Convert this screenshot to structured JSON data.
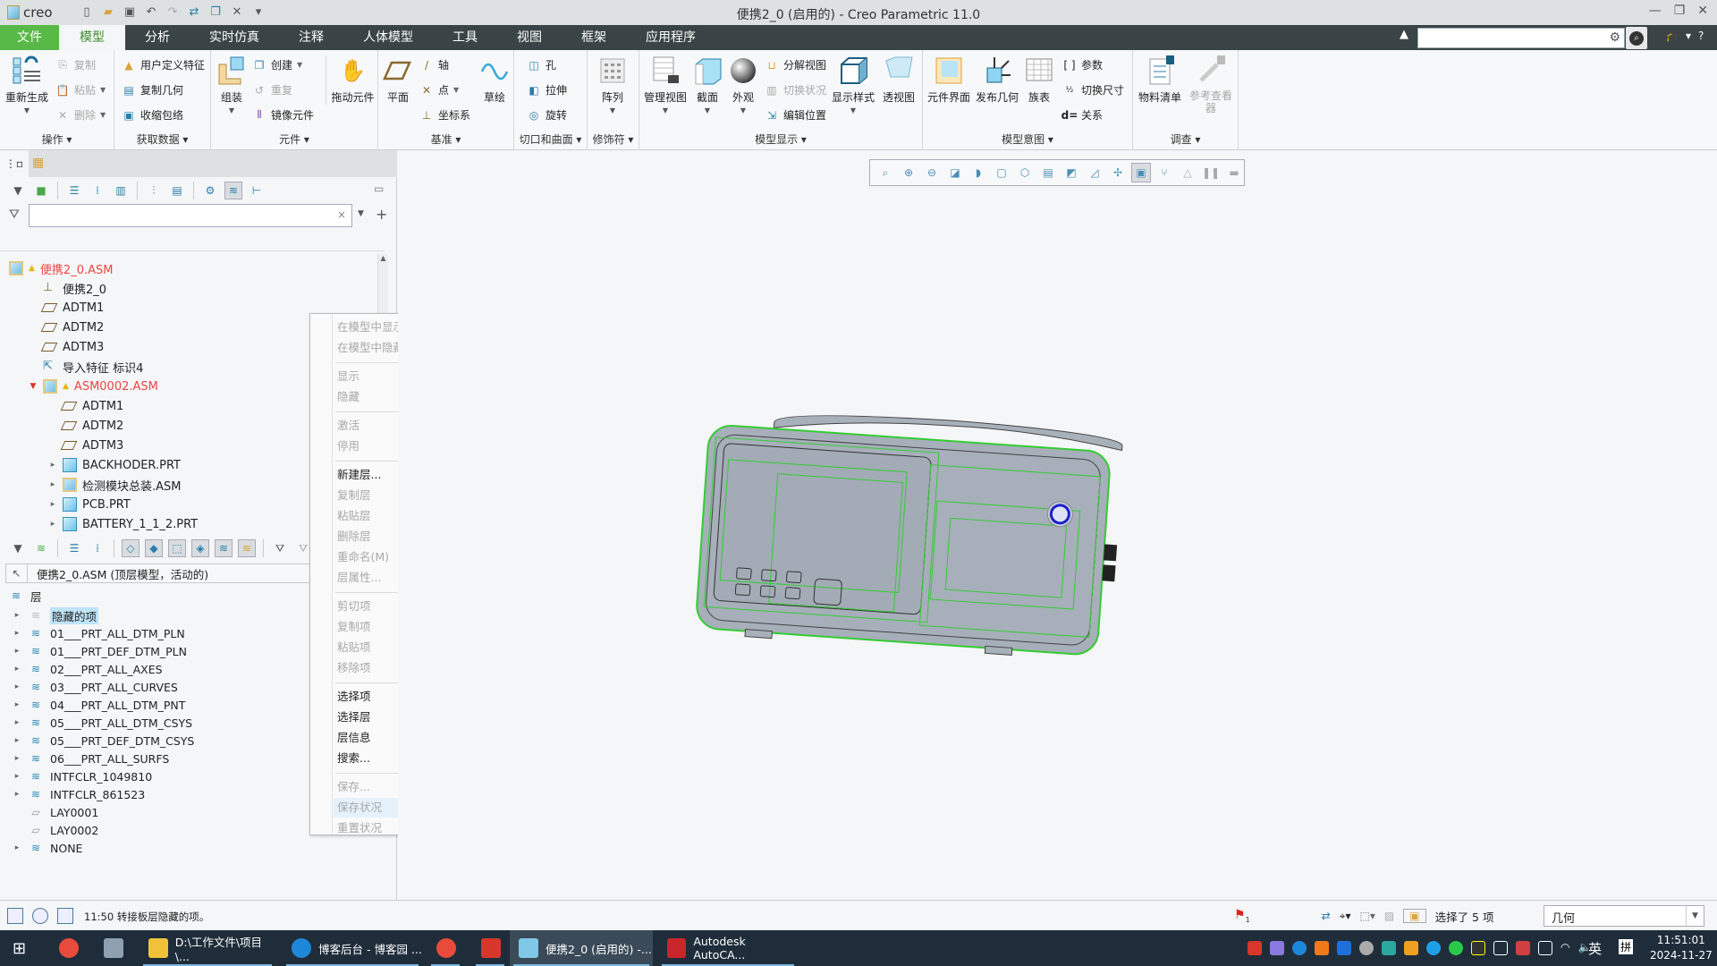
{
  "app": {
    "logo_text": "creo",
    "window_title": "便携2_0 (启用的) - Creo Parametric 11.0",
    "quick_access": [
      "new-icon",
      "open-icon",
      "save-icon",
      "undo-icon",
      "redo-icon",
      "regenerate-icon",
      "windows-icon",
      "close-icon",
      "customize-icon"
    ]
  },
  "menubar": {
    "tabs": [
      "文件",
      "模型",
      "分析",
      "实时仿真",
      "注释",
      "人体模型",
      "工具",
      "视图",
      "框架",
      "应用程序"
    ],
    "active": "模型",
    "search_placeholder": ""
  },
  "ribbon": {
    "groups": [
      {
        "label": "操作 ▾",
        "big": [
          {
            "label": "重新生成",
            "icon": "regenerate-icon"
          }
        ],
        "small": [
          {
            "label": "复制",
            "disabled": true
          },
          {
            "label": "粘贴",
            "disabled": true
          },
          {
            "label": "删除",
            "disabled": true
          }
        ]
      },
      {
        "label": "获取数据 ▾",
        "small": [
          {
            "label": "用户定义特征"
          },
          {
            "label": "复制几何"
          },
          {
            "label": "收缩包络"
          }
        ]
      },
      {
        "label": "元件 ▾",
        "big": [
          {
            "label": "组装"
          },
          {
            "label": "拖动元件"
          }
        ],
        "small": [
          {
            "label": "创建"
          },
          {
            "label": "重复",
            "disabled": true
          },
          {
            "label": "镜像元件"
          }
        ]
      },
      {
        "label": "基准 ▾",
        "big": [
          {
            "label": "平面"
          },
          {
            "label": "草绘"
          }
        ],
        "small": [
          {
            "label": "轴"
          },
          {
            "label": "点"
          },
          {
            "label": "坐标系"
          }
        ]
      },
      {
        "label": "切口和曲面 ▾",
        "small": [
          {
            "label": "孔"
          },
          {
            "label": "拉伸"
          },
          {
            "label": "旋转"
          }
        ]
      },
      {
        "label": "修饰符 ▾",
        "big": [
          {
            "label": "阵列"
          }
        ]
      },
      {
        "label": "模型显示 ▾",
        "big": [
          {
            "label": "管理视图"
          },
          {
            "label": "截面"
          },
          {
            "label": "外观"
          },
          {
            "label": "显示样式"
          },
          {
            "label": "透视图"
          }
        ],
        "small": [
          {
            "label": "分解视图"
          },
          {
            "label": "切换状况",
            "disabled": true
          },
          {
            "label": "编辑位置"
          }
        ]
      },
      {
        "label": "模型意图 ▾",
        "big": [
          {
            "label": "元件界面"
          },
          {
            "label": "发布几何"
          },
          {
            "label": "族表"
          }
        ],
        "small": [
          {
            "label": "参数"
          },
          {
            "label": "切换尺寸"
          },
          {
            "label": "关系"
          }
        ]
      },
      {
        "label": "调查 ▾",
        "big": [
          {
            "label": "物料清单"
          },
          {
            "label": "参考查看器",
            "disabled": true
          }
        ]
      }
    ]
  },
  "model_tree": {
    "filter_value": "",
    "items": [
      {
        "label": "便携2_0.ASM",
        "level": 0,
        "type": "asm",
        "red": true,
        "warn": true
      },
      {
        "label": "便携2_0",
        "level": 1,
        "type": "csys"
      },
      {
        "label": "ADTM1",
        "level": 1,
        "type": "plane"
      },
      {
        "label": "ADTM2",
        "level": 1,
        "type": "plane"
      },
      {
        "label": "ADTM3",
        "level": 1,
        "type": "plane"
      },
      {
        "label": "导入特征 标识4",
        "level": 1,
        "type": "import"
      },
      {
        "label": "ASM0002.ASM",
        "level": 1,
        "type": "asm",
        "red": true,
        "warn": true,
        "expanded": true
      },
      {
        "label": "ADTM1",
        "level": 2,
        "type": "plane"
      },
      {
        "label": "ADTM2",
        "level": 2,
        "type": "plane"
      },
      {
        "label": "ADTM3",
        "level": 2,
        "type": "plane"
      },
      {
        "label": "BACKHODER.PRT",
        "level": 2,
        "type": "part",
        "collapsed": true
      },
      {
        "label": "检测模块总装.ASM",
        "level": 2,
        "type": "asm",
        "collapsed": true
      },
      {
        "label": "PCB.PRT",
        "level": 2,
        "type": "part",
        "collapsed": true,
        "flag": true
      },
      {
        "label": "BATTERY_1_1_2.PRT",
        "level": 2,
        "type": "part",
        "collapsed": true,
        "flag": true
      }
    ]
  },
  "layer_tree": {
    "owner": "便携2_0.ASM (顶层模型，活动的)",
    "root": "层",
    "items": [
      {
        "label": "隐藏的项",
        "selected": true,
        "gray": true
      },
      {
        "label": "01___PRT_ALL_DTM_PLN"
      },
      {
        "label": "01___PRT_DEF_DTM_PLN"
      },
      {
        "label": "02___PRT_ALL_AXES"
      },
      {
        "label": "03___PRT_ALL_CURVES"
      },
      {
        "label": "04___PRT_ALL_DTM_PNT"
      },
      {
        "label": "05___PRT_ALL_DTM_CSYS"
      },
      {
        "label": "05___PRT_DEF_DTM_CSYS"
      },
      {
        "label": "06___PRT_ALL_SURFS"
      },
      {
        "label": "INTFCLR_1049810"
      },
      {
        "label": "INTFCLR_861523"
      },
      {
        "label": "LAY0001",
        "empty": true
      },
      {
        "label": "LAY0002",
        "empty": true
      },
      {
        "label": "NONE"
      }
    ]
  },
  "context_menu": {
    "items": [
      {
        "label": "在模型中显示",
        "disabled": true
      },
      {
        "label": "在模型中隐藏",
        "disabled": true
      },
      {
        "sep": true
      },
      {
        "label": "显示",
        "disabled": true
      },
      {
        "label": "隐藏",
        "disabled": true
      },
      {
        "sep": true
      },
      {
        "label": "激活",
        "disabled": true
      },
      {
        "label": "停用",
        "disabled": true
      },
      {
        "sep": true
      },
      {
        "label": "新建层...",
        "disabled": false
      },
      {
        "label": "复制层",
        "disabled": true
      },
      {
        "label": "粘贴层",
        "disabled": true
      },
      {
        "label": "删除层",
        "disabled": true
      },
      {
        "label": "重命名(M)",
        "disabled": true
      },
      {
        "label": "层属性...",
        "disabled": true
      },
      {
        "sep": true
      },
      {
        "label": "剪切项",
        "disabled": true
      },
      {
        "label": "复制项",
        "disabled": true
      },
      {
        "label": "粘贴项",
        "disabled": true
      },
      {
        "label": "移除项",
        "disabled": true
      },
      {
        "sep": true
      },
      {
        "label": "选择项",
        "disabled": false
      },
      {
        "label": "选择层",
        "disabled": false
      },
      {
        "label": "层信息",
        "disabled": false
      },
      {
        "label": "搜索...",
        "disabled": false
      },
      {
        "sep": true
      },
      {
        "label": "保存...",
        "disabled": true
      },
      {
        "label": "保存状况",
        "disabled": true,
        "hover": true
      },
      {
        "label": "重置状况",
        "disabled": true
      }
    ]
  },
  "view_toolbar": [
    "refit-icon",
    "zoom-in-icon",
    "zoom-out-icon",
    "repaint-icon",
    "display-style-icon",
    "saved-orientations-icon",
    "view-manager-icon",
    "named-views-icon",
    "perspective-icon",
    "section-icon",
    "datum-display-icon",
    "annotation-display-icon",
    "spin-center-icon",
    "simulation-icon",
    "pause-icon",
    "stop-icon"
  ],
  "status": {
    "message": "11:50 转接板层隐藏的项。",
    "selection_count": "选择了 5 项",
    "filter": "几何",
    "flag_count": "1"
  },
  "taskbar": {
    "items": [
      {
        "label": "D:\\工作文件\\项目\\...",
        "color": "#f0c23a"
      },
      {
        "label": "博客后台 - 博客园 ...",
        "color": "#1e88d8"
      },
      {
        "label": "",
        "color": "#e84b3c"
      },
      {
        "label": "",
        "color": "#d9362b"
      },
      {
        "label": "便携2_0 (启用的) -...",
        "color": "#7fc8e8",
        "active": true
      },
      {
        "label": "Autodesk AutoCA...",
        "color": "#c8262b"
      }
    ],
    "ime": "英",
    "ime2": "拼",
    "time": "11:51:01",
    "date": "2024-11-27"
  },
  "colors": {
    "accent_green": "#58b947",
    "menubar": "#3a4446",
    "model_edge": "#2ecc2e",
    "warning": "#e44444"
  }
}
